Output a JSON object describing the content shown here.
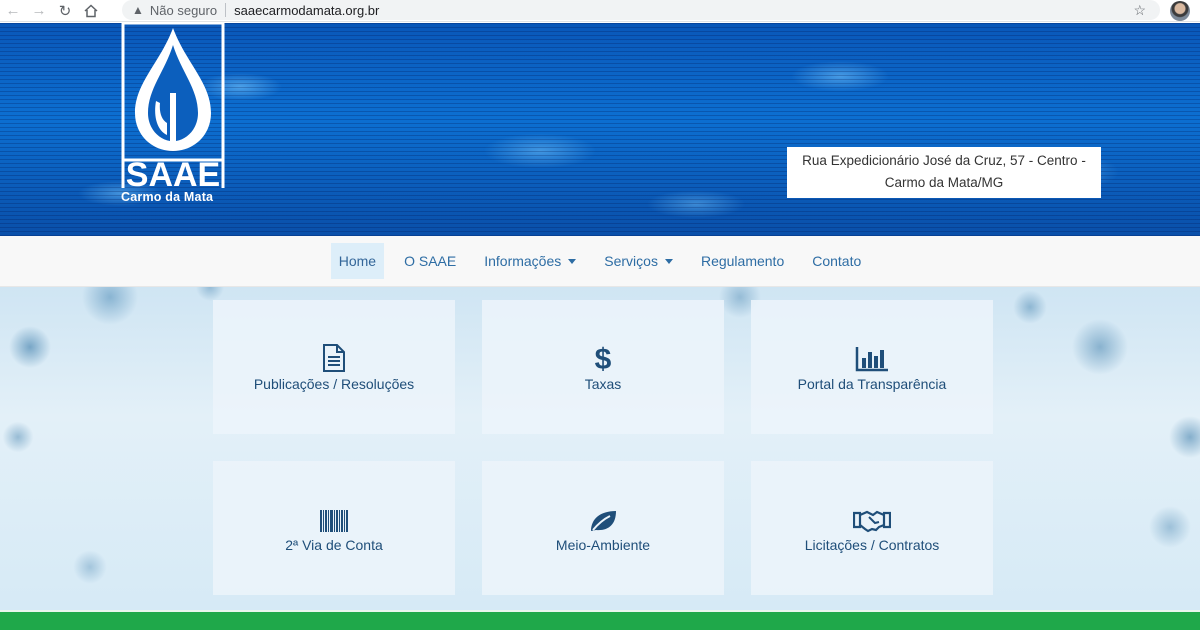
{
  "browser": {
    "security_label": "Não seguro",
    "url": "saaecarmodamata.org.br"
  },
  "header": {
    "logo_text": "SAAE",
    "logo_subtitle": "Carmo da Mata",
    "address_line1": "Rua Expedicionário José da Cruz, 57 - Centro -",
    "address_line2": "Carmo da Mata/MG"
  },
  "nav": {
    "items": [
      {
        "label": "Home"
      },
      {
        "label": "O SAAE"
      },
      {
        "label": "Informações"
      },
      {
        "label": "Serviços"
      },
      {
        "label": "Regulamento"
      },
      {
        "label": "Contato"
      }
    ]
  },
  "tiles": [
    {
      "label": "Publicações / Resoluções",
      "icon": "document-icon"
    },
    {
      "label": "Taxas",
      "icon": "dollar-icon"
    },
    {
      "label": "Portal da Transparência",
      "icon": "bar-chart-icon"
    },
    {
      "label": "2ª Via de Conta",
      "icon": "barcode-icon"
    },
    {
      "label": "Meio-Ambiente",
      "icon": "leaf-icon"
    },
    {
      "label": "Licitações / Contratos",
      "icon": "handshake-icon"
    }
  ],
  "colors": {
    "accent": "#2e6da4",
    "banner_blue": "#0c6fd1",
    "green_bar": "#1fa84a",
    "icon_color": "#1f4e79"
  }
}
